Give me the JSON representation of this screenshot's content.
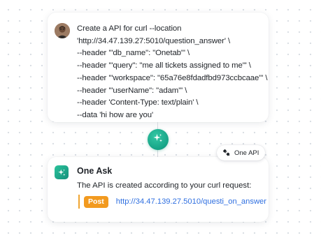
{
  "request": {
    "lines": [
      "Create a API for curl --location",
      "'http://34.47.139.27:5010/question_answer' \\",
      "--header '\"db_name\": \"Onetab\"' \\",
      "--header '\"query\": \"me all tickets assigned to me\"' \\",
      "--header '\"workspace\": \"65a76e8fdadfbd973ccbcaae\"' \\",
      "--header '\"userName\": \"adam\"' \\",
      "--header 'Content-Type: text/plain' \\",
      "--data 'hi how are you'"
    ],
    "avatar_icon": "user-avatar"
  },
  "connector": {
    "node_icon": "sparkle-icon",
    "tag_icon": "plug-icon",
    "tag_label": "One API"
  },
  "response": {
    "icon": "sparkle-icon",
    "title": "One Ask",
    "message": "The API is created according to your curl request:",
    "method": "Post",
    "endpoint": "http://34.47.139.27.5010/questi_on_answer"
  },
  "colors": {
    "accent_green": "#16a386",
    "method_orange": "#f29a1f",
    "link_blue": "#2f6fe0"
  }
}
